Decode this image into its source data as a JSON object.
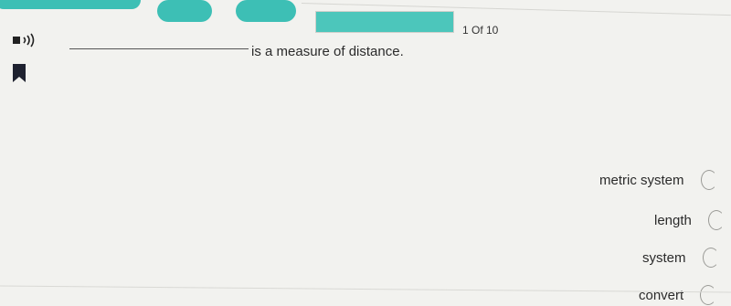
{
  "header": {
    "counter": "1 Of 10",
    "progress_fraction": 1.0,
    "accent_color": "#3dbfb5"
  },
  "question": {
    "prompt": "is a measure of distance.",
    "audio_icon": "speaker-icon",
    "bookmark_icon": "bookmark-icon"
  },
  "options": [
    {
      "label": "metric system"
    },
    {
      "label": "length"
    },
    {
      "label": "system"
    },
    {
      "label": "convert"
    }
  ]
}
